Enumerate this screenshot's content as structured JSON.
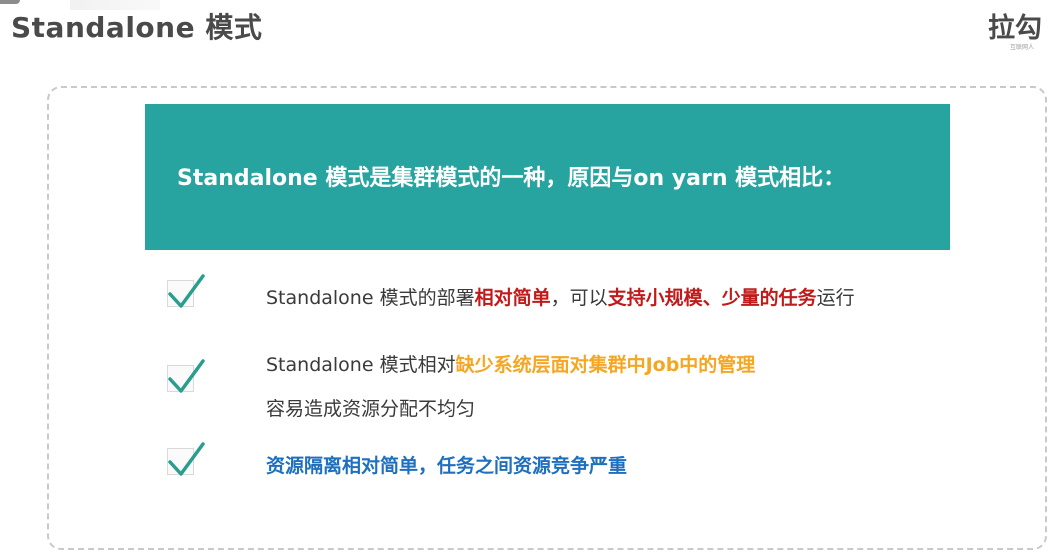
{
  "header": {
    "title": "Standalone 模式",
    "brand": "拉勾",
    "brand_sub": "互联网人"
  },
  "banner": {
    "text": "Standalone 模式是集群模式的一种，原因与on yarn 模式相比："
  },
  "items": [
    {
      "p1": "Standalone 模式的部署",
      "p2": "相对简单",
      "p3": "，可以",
      "p4": "支持小规模、少量的任务",
      "p5": "运行"
    },
    {
      "p1": "Standalone 模式相对",
      "p2": "缺少系统层面对集群中Job中的管理",
      "line2": "容易造成资源分配不均匀"
    },
    {
      "p1": "资源隔离相对简单，任务之间资源竞争严重"
    }
  ],
  "colors": {
    "banner_bg": "#27a3a0",
    "check_green": "#2a9d8f",
    "highlight_red": "#c11a1a",
    "highlight_orange": "#f5a623",
    "highlight_blue": "#1f6fbf"
  }
}
